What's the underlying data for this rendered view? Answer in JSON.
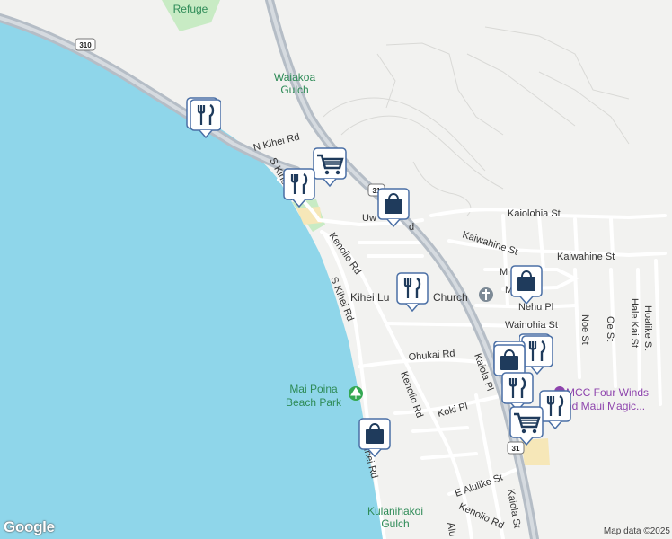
{
  "map": {
    "attribution": "Map data ©2025",
    "logo": "Google",
    "colors": {
      "water": "#8fd6ea",
      "land": "#f2f2f0",
      "park": "#c8ebc4",
      "highway": "#b5bdc6",
      "road": "#ffffff",
      "marker_fill": "#ffffff",
      "marker_border": "#4a6fa5",
      "icon": "#1f3b5c",
      "poi": "#8e44ad"
    }
  },
  "roads": {
    "n_kihei_rd": "N Kihei Rd",
    "s_kihei_rd_upper": "S Kihei Rd",
    "s_kihei_rd_mid": "S Kihei Rd",
    "s_kihei_rd_lower": "ihei Rd",
    "kenolio_rd_upper": "Kenolio Rd",
    "kenolio_rd_mid": "Kenolio Rd",
    "kenolio_rd_lower": "Kenolio Rd",
    "uwapo_rd": "Uw",
    "uwapo_rd_tail": "d",
    "kaiolohia_st": "Kaiolohia St",
    "kaiwahine_st_left": "Kaiwahine St",
    "kaiwahine_st_right": "Kaiwahine St",
    "nehu_pl": "Nehu Pl",
    "wainohia_st": "Wainohia St",
    "ohukai_rd": "Ohukai Rd",
    "kaiola_pl": "Kaiola Pl",
    "koki_pl": "Koki Pl",
    "noe_st": "Noe St",
    "oe_st": "Oe St",
    "hale_kai_st": "Hale Kai St",
    "hoalike_st": "Hoalike St",
    "e_alulike_st": "E Alulike St",
    "kaiola_st": "Kaiola St",
    "alu": "Alu",
    "m_label_1": "M",
    "m_label_2": "M"
  },
  "shields": {
    "route_310": "310",
    "route_31_upper": "31",
    "route_31_lower": "31"
  },
  "places": {
    "refuge": "Refuge",
    "waiakoa_gulch_1": "Waiakoa",
    "waiakoa_gulch_2": "Gulch",
    "mai_poina_1": "Mai Poina",
    "mai_poina_2": "Beach Park",
    "kulanihakoi_1": "Kulanihakoi",
    "kulanihakoi_2": "Gulch",
    "kihei_church": "Kihei Lu",
    "kihei_church_tail": "Church",
    "mcc_1": "MCC Four Winds",
    "mcc_2": "nd Maui Magic..."
  },
  "markers": [
    {
      "name": "restaurant-marker-1",
      "icon": "fork-knife-icon",
      "stack": 2
    },
    {
      "name": "restaurant-marker-2",
      "icon": "fork-knife-icon",
      "stack": 1
    },
    {
      "name": "grocery-marker-1",
      "icon": "shopping-cart-icon",
      "stack": 1
    },
    {
      "name": "shopping-marker-1",
      "icon": "shopping-bag-icon",
      "stack": 1
    },
    {
      "name": "restaurant-marker-3",
      "icon": "fork-knife-icon",
      "stack": 1
    },
    {
      "name": "shopping-marker-2",
      "icon": "shopping-bag-icon",
      "stack": 1
    },
    {
      "name": "restaurant-marker-4",
      "icon": "fork-knife-icon",
      "stack": 2
    },
    {
      "name": "shopping-marker-3",
      "icon": "shopping-bag-icon",
      "stack": 1
    },
    {
      "name": "restaurant-marker-5",
      "icon": "fork-knife-icon",
      "stack": 1
    },
    {
      "name": "restaurant-marker-6",
      "icon": "fork-knife-icon",
      "stack": 1
    },
    {
      "name": "grocery-marker-2",
      "icon": "shopping-cart-icon",
      "stack": 1
    },
    {
      "name": "shopping-marker-4",
      "icon": "shopping-bag-icon",
      "stack": 1
    }
  ]
}
